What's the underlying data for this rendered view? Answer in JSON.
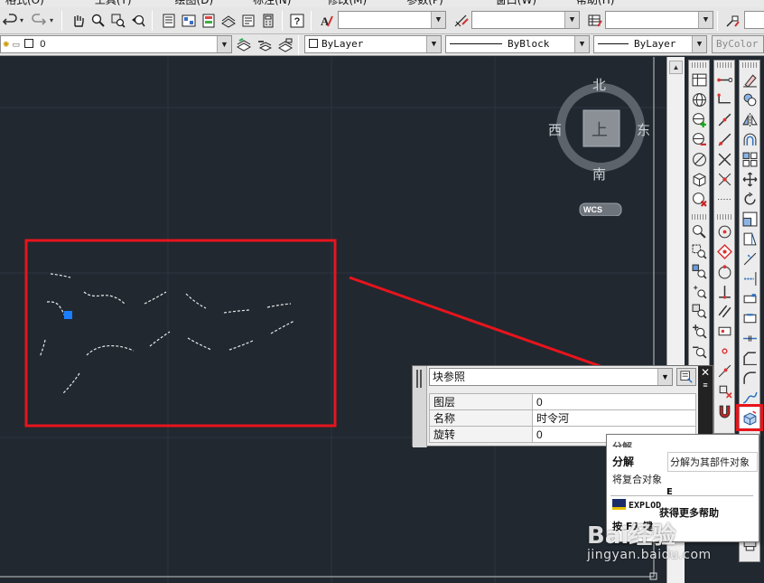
{
  "menubar": {
    "items": [
      "格式(O)",
      "工具(T)",
      "绘图(D)",
      "标注(N)",
      "修改(M)",
      "参数(P)",
      "窗口(W)",
      "帮助(H)"
    ]
  },
  "toolbar2": {
    "layer_value": "0",
    "color_value": "ByLayer",
    "linetype_value": "ByBlock",
    "lineweight_value": "ByLayer",
    "plotstyle_value": "ByColor"
  },
  "viewcube": {
    "north": "北",
    "south": "南",
    "east": "东",
    "west": "西",
    "face": "上",
    "wcs_label": "WCS"
  },
  "properties": {
    "object_type": "块参照",
    "rows": [
      {
        "key": "图层",
        "value": "0"
      },
      {
        "key": "名称",
        "value": "时令河"
      },
      {
        "key": "旋转",
        "value": "0"
      }
    ]
  },
  "tooltip": {
    "title_top": "分解",
    "title": "分解",
    "bubble_text": "分解为其部件对象",
    "description": "将复合对象",
    "command_fragment": "E",
    "command": "EXPLOD",
    "help": "获得更多帮助",
    "footer": "按 F1 键"
  },
  "watermark": {
    "brand": "Bai经验",
    "url": "jingyan.baidu.com"
  },
  "colors": {
    "canvas": "#212830",
    "highlight_red": "#e8141c",
    "grip_blue": "#1a7fff"
  }
}
